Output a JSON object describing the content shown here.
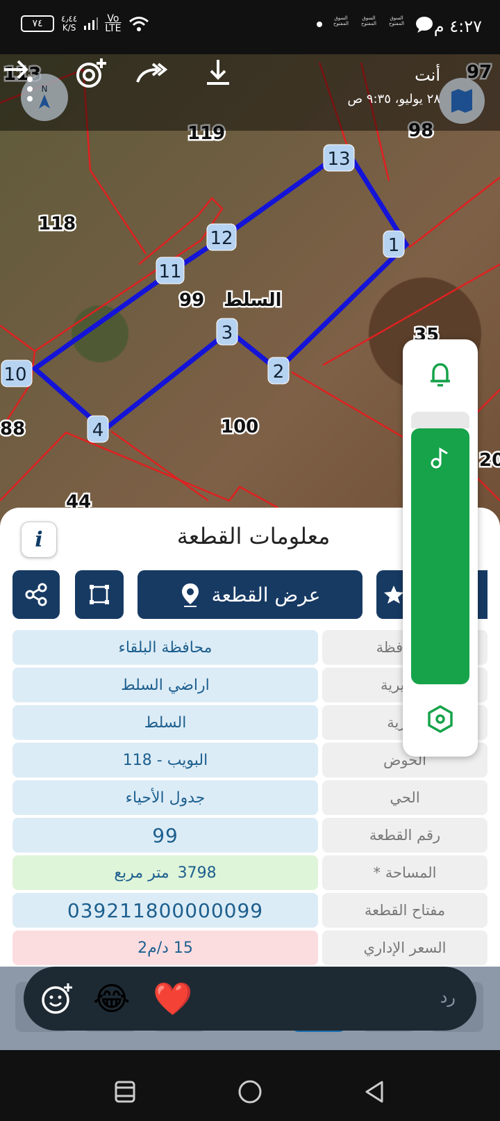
{
  "status_bar": {
    "time": "٤:٢٧ م",
    "battery": "٧٤",
    "net_speed_value": "٤٫٤٤",
    "net_speed_unit": "K/S",
    "volte_top": "Vo",
    "volte_bottom": "LTE",
    "app_icon_label": "السوق المفتوح"
  },
  "map_header": {
    "title": "أنت",
    "subtitle": "٢٨ يوليو، ٩:٣٥ ص"
  },
  "map": {
    "parcel_labels": [
      "113",
      "119",
      "97",
      "98",
      "118",
      "99",
      "100",
      "88",
      "44",
      "35",
      "20"
    ],
    "town_label": "السلط",
    "points": [
      "1",
      "2",
      "3",
      "4",
      "10",
      "11",
      "12",
      "13"
    ]
  },
  "info_sheet": {
    "title": "معلومات القطعة",
    "info_icon": "i",
    "show_parcel_button": "عرض القطعة",
    "rows": [
      {
        "label": "المحافظة",
        "value": "محافظة البلقاء"
      },
      {
        "label": "المديرية",
        "value": "اراضي السلط"
      },
      {
        "label": "القرية",
        "value": "السلط"
      },
      {
        "label": "الحوض",
        "value": "البويب - 118"
      },
      {
        "label": "الحي",
        "value": "جدول الأحياء"
      },
      {
        "label": "رقم القطعة",
        "value": "99"
      },
      {
        "label": "المساحة *",
        "value": "3798",
        "unit": "متر مربع"
      },
      {
        "label": "مفتاح القطعة",
        "value": "039211800000099"
      },
      {
        "label": "السعر الإداري",
        "value": "15 د/م2"
      }
    ]
  },
  "reaction_bar": {
    "emoji_laugh": "😂",
    "emoji_heart": "❤️",
    "reply_placeholder": "رد"
  },
  "colors": {
    "accent_dark": "#173a63",
    "green": "#16a34a",
    "value_blue": "#1d5f8e"
  }
}
